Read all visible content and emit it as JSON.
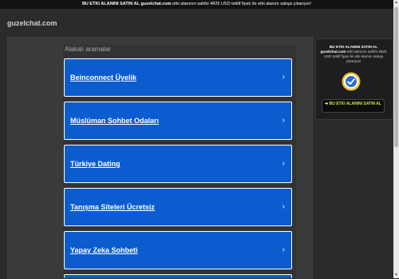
{
  "topbar": {
    "prefix": "BU ETKI ALANINI SATIN AL",
    "domain": "guzelchat.com",
    "suffix": "etki alanının sahibi 4825 USD teklif fiyatı ile etki alanını satışa çıkarıyor!"
  },
  "header": {
    "site_name": "guzelchat.com"
  },
  "main": {
    "related_title": "Alakalı aramalar",
    "results": [
      {
        "label": "Beinconnect Üyelik"
      },
      {
        "label": "Müslüman Sohbet Odaları"
      },
      {
        "label": "Türkiye Dating"
      },
      {
        "label": "Tanışma Siteleri Ücretsiz"
      },
      {
        "label": "Yapay Zeka Sohbeti"
      },
      {
        "label": ""
      }
    ]
  },
  "sidebar": {
    "heading": "BU ETKI ALANINI SATIN AL",
    "domain": "guzelchat.com",
    "body": "etki alanının sahibi 4825 USD teklif fiyatı ile etki alanını satışa çıkarıyor!",
    "button_label": "BU ETKI ALANINI SATIN AL",
    "button_icon": "arrow-right-icon",
    "seal_icon": "verified-seal-icon"
  },
  "colors": {
    "background": "#2b2b2b",
    "result_blue": "#0b5ccf",
    "button_text": "#c8e84a"
  }
}
